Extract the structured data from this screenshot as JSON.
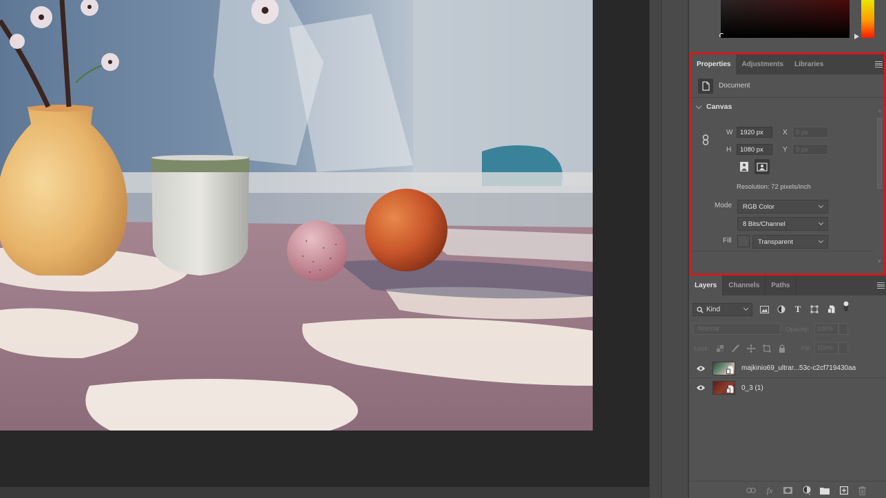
{
  "colors": {
    "highlight_border": "#d21a1a",
    "panel_bg": "#535353",
    "tabbar_bg": "#424242",
    "canvas_bg": "#282828"
  },
  "color_picker": {
    "hue_gradient": [
      "#e6e600",
      "#ff9900",
      "#ff1a00"
    ]
  },
  "properties": {
    "tabs": [
      {
        "label": "Properties",
        "active": true
      },
      {
        "label": "Adjustments",
        "active": false
      },
      {
        "label": "Libraries",
        "active": false
      }
    ],
    "menu_icon": "hamburger-menu-icon",
    "document_label": "Document",
    "canvas_section": "Canvas",
    "width_label": "W",
    "width_value": "1920 px",
    "height_label": "H",
    "height_value": "1080 px",
    "x_label": "X",
    "x_value": "0 px",
    "y_label": "Y",
    "y_value": "0 px",
    "link_icon": "link-icon",
    "orientation": {
      "portrait_icon": "portrait-icon",
      "landscape_icon": "landscape-icon",
      "selected": "landscape"
    },
    "resolution": "Resolution: 72 pixels/inch",
    "mode_label": "Mode",
    "mode_value": "RGB Color",
    "bits_value": "8 Bits/Channel",
    "fill_label": "Fill",
    "fill_value": "Transparent"
  },
  "layers": {
    "tabs": [
      {
        "label": "Layers",
        "active": true
      },
      {
        "label": "Channels",
        "active": false
      },
      {
        "label": "Paths",
        "active": false
      }
    ],
    "filter_kind": "Kind",
    "blend_mode": "Normal",
    "opacity_label": "Opacity:",
    "opacity_value": "100%",
    "lock_label": "Lock:",
    "fill_label": "Fill:",
    "fill_value": "100%",
    "items": [
      {
        "name": "majkinio69_ultrar...53c-c2cf719430aa",
        "visible": true
      },
      {
        "name": "0_3 (1)",
        "visible": true
      }
    ],
    "footer_icons": [
      "link-layers-icon",
      "fx-icon",
      "mask-icon",
      "adjustment-layer-icon",
      "group-folder-icon",
      "new-layer-icon",
      "trash-icon"
    ]
  }
}
